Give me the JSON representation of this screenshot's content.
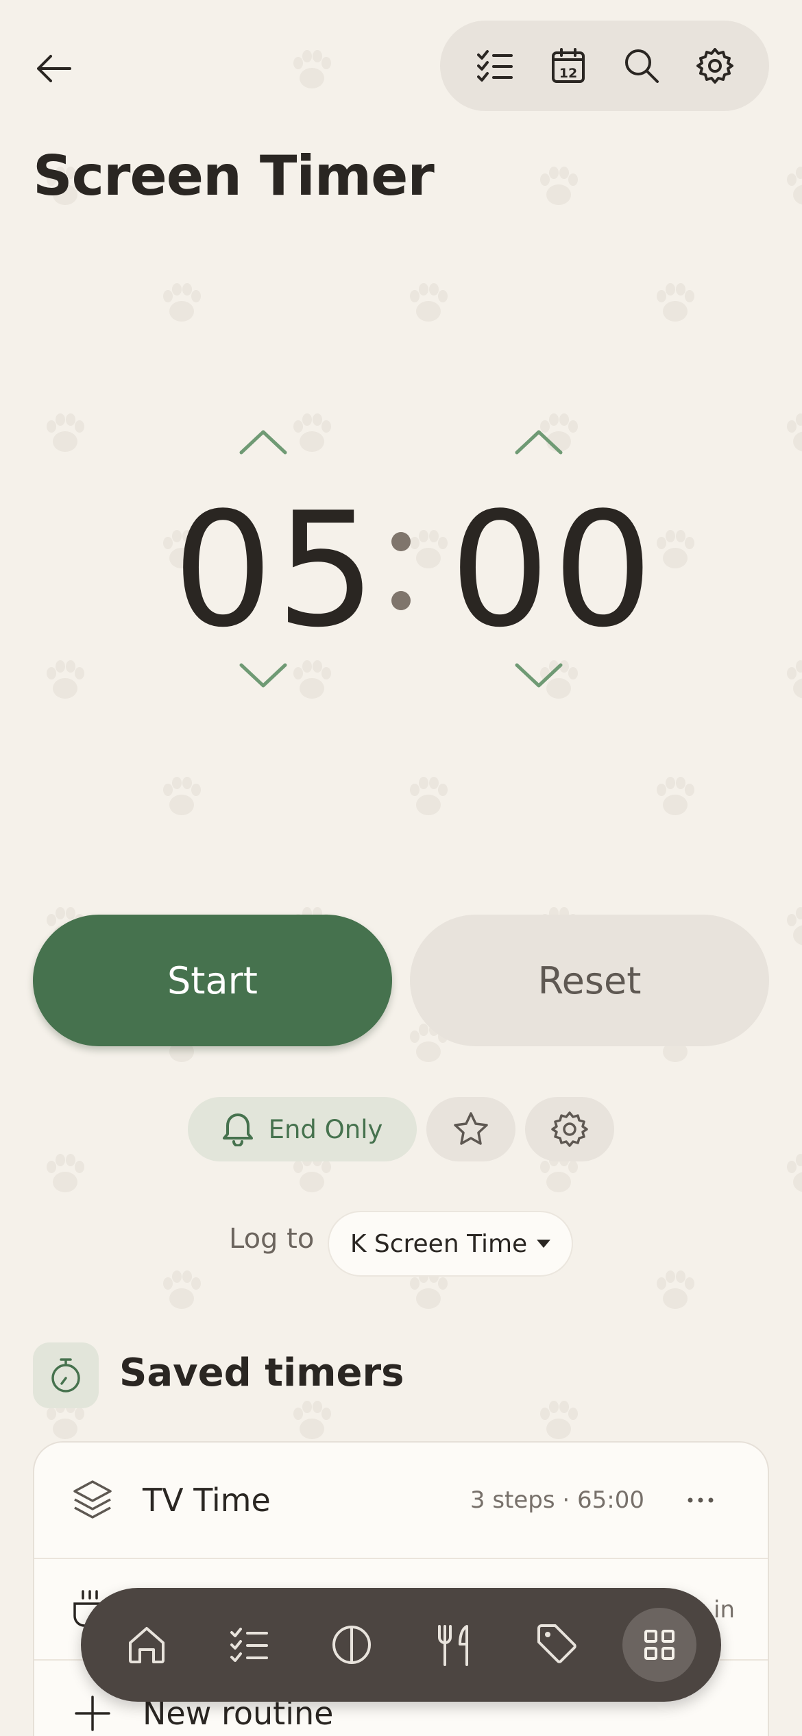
{
  "header": {
    "back_icon": "arrow-left-icon",
    "toolbar_icons": [
      "checklist-icon",
      "calendar-icon",
      "search-icon",
      "gear-icon"
    ],
    "calendar_day": "12"
  },
  "page": {
    "title": "Screen Timer"
  },
  "timer": {
    "minutes": "05",
    "seconds": "00"
  },
  "actions": {
    "start_label": "Start",
    "reset_label": "Reset"
  },
  "options": {
    "alert_mode": "End Only",
    "favorite_icon": "star-icon",
    "settings_icon": "gear-icon"
  },
  "log": {
    "label": "Log to",
    "selected": "K Screen Time"
  },
  "saved": {
    "title": "Saved timers",
    "items": [
      {
        "name": "TV Time",
        "meta": "3 steps · 65:00",
        "icon": "layers-icon"
      },
      {
        "name": "",
        "meta": "in",
        "icon": "coffee-cup-icon"
      }
    ],
    "new_label": "New routine"
  },
  "nav": {
    "items": [
      "home-icon",
      "checklist-icon",
      "contrast-icon",
      "fork-knife-icon",
      "tag-icon",
      "grid-icon"
    ],
    "active_index": 5
  },
  "colors": {
    "background": "#f5f1ea",
    "accent_green": "#46724e",
    "text_dark": "#2a2622",
    "nav_bg": "#4c4541"
  }
}
